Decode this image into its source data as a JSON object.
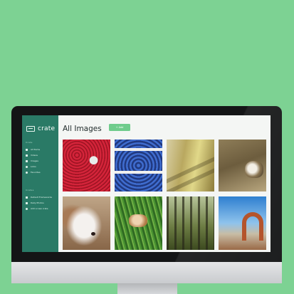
{
  "app": {
    "name": "crate"
  },
  "sidebar": {
    "section1_heading": "Crate",
    "items": [
      {
        "label": "All Items",
        "icon": "grid-icon"
      },
      {
        "label": "Videos",
        "icon": "video-icon"
      },
      {
        "label": "Images",
        "icon": "image-icon"
      },
      {
        "label": "Links",
        "icon": "link-icon"
      },
      {
        "label": "Favorites",
        "icon": "heart-icon"
      }
    ],
    "section2_heading": "Crates",
    "crates": [
      {
        "label": "Default Frameworks",
        "icon": "folder-icon"
      },
      {
        "label": "Daily Photos",
        "icon": "folder-icon"
      },
      {
        "label": "Add a new crate",
        "icon": "plus-icon"
      }
    ]
  },
  "main": {
    "title": "All Images",
    "add_label": "+ Add"
  },
  "images": [
    {
      "subject": "strawberries",
      "icon": "strawberries-photo"
    },
    {
      "subject": "blueberries",
      "icon": "blueberries-photo"
    },
    {
      "subject": "market",
      "icon": "market-photo"
    },
    {
      "subject": "cat",
      "icon": "cat-photo"
    },
    {
      "subject": "dog",
      "icon": "dog-photo"
    },
    {
      "subject": "puppy",
      "icon": "puppy-photo"
    },
    {
      "subject": "forest",
      "icon": "forest-photo"
    },
    {
      "subject": "arch",
      "icon": "arch-photo"
    }
  ],
  "colors": {
    "background": "#7dd293",
    "sidebar": "#2a7a66",
    "accent": "#6fcc8c"
  }
}
